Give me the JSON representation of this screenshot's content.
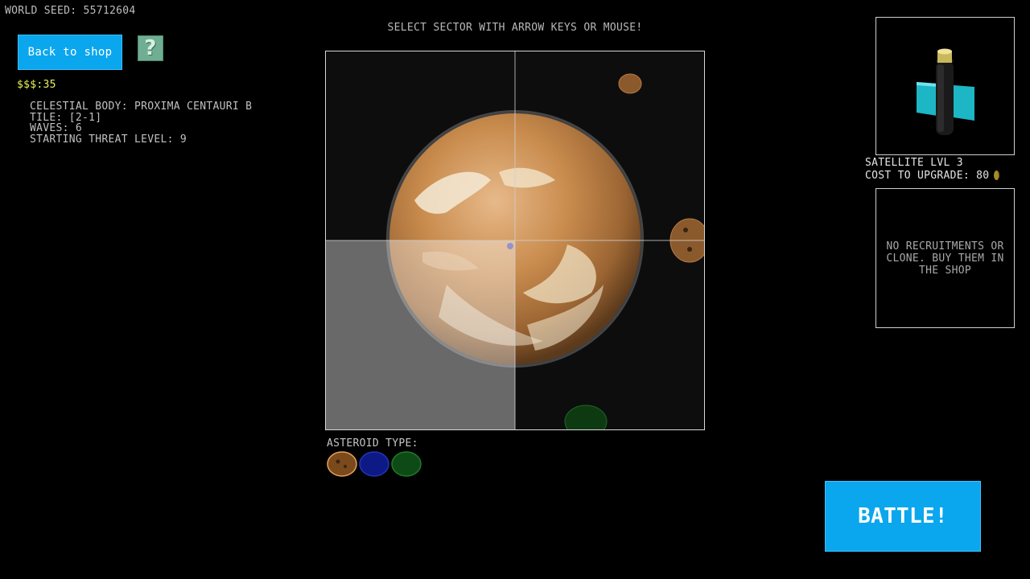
{
  "world_seed": "WORLD SEED: 55712604",
  "back_button": "Back to shop",
  "help_icon_glyph": "?",
  "money": "$$$:35",
  "info": {
    "celestial_body": "CELESTIAL BODY: PROXIMA CENTAURI B",
    "tile": "TILE: [2-1]",
    "waves": "WAVES: 6",
    "threat": "STARTING THREAT LEVEL: 9"
  },
  "prompt": "SELECT SECTOR WITH ARROW KEYS OR MOUSE!",
  "grid": {
    "rows": 2,
    "cols": 2,
    "selected_sector": "2-1"
  },
  "asteroid_label": "ASTEROID TYPE:",
  "asteroid_types": [
    {
      "name": "brown",
      "color": "#7a4a1c",
      "outline": "#e5a35c",
      "selected": true
    },
    {
      "name": "blue",
      "color": "#0d1a86",
      "outline": "#2433b8",
      "selected": false
    },
    {
      "name": "green",
      "color": "#0e4a16",
      "outline": "#1f7a2a",
      "selected": false
    }
  ],
  "satellite": {
    "level": "SATELLITE LVL 3",
    "upgrade": "COST TO UPGRADE: 80"
  },
  "recruit_message": "NO RECRUITMENTS OR CLONE. BUY THEM IN THE SHOP",
  "battle_button": "BATTLE!",
  "colors": {
    "accent": "#0aa6ee",
    "money": "#e8f25a",
    "planet": "#c98c4e"
  }
}
